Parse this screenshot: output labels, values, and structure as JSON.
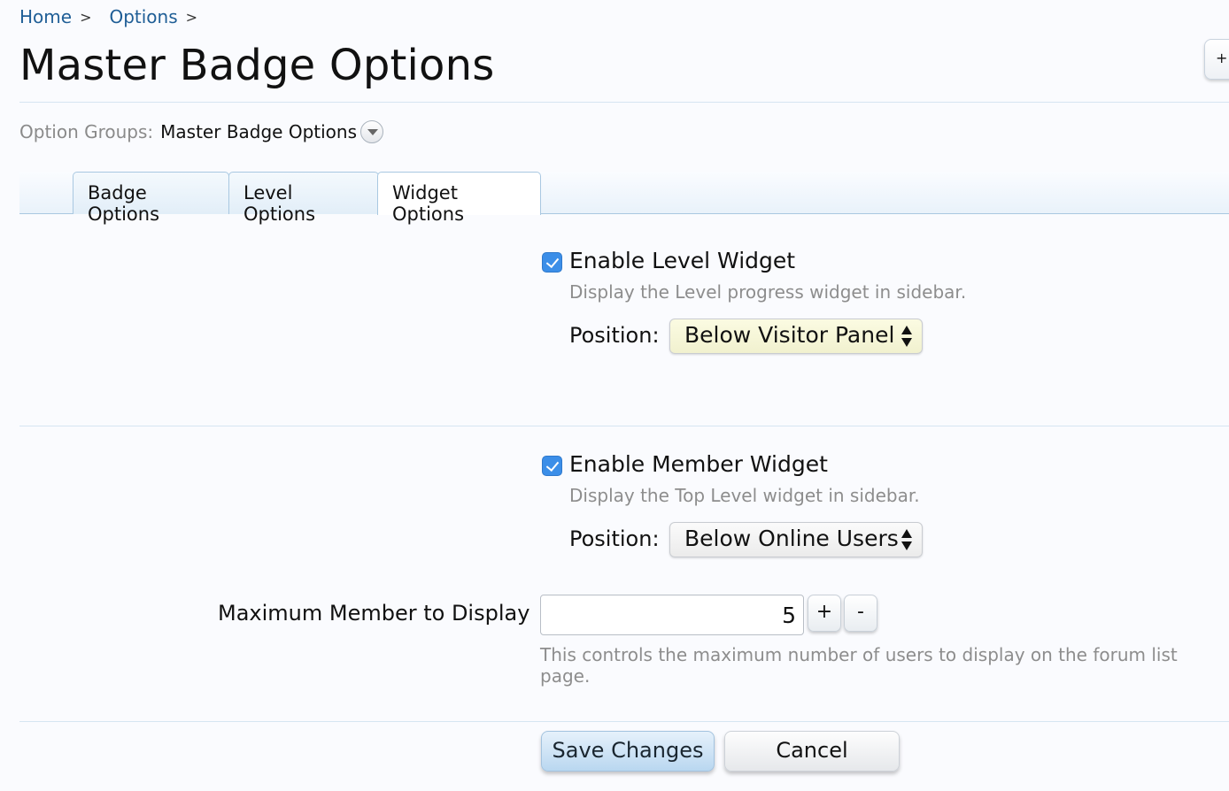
{
  "breadcrumb": {
    "home": "Home",
    "options": "Options",
    "separator": ">"
  },
  "page_title": "Master Badge Options",
  "corner_button_label": "+",
  "option_groups": {
    "label": "Option Groups:",
    "value": "Master Badge Options"
  },
  "tabs": [
    {
      "label": "Badge Options",
      "active": false
    },
    {
      "label": "Level Options",
      "active": false
    },
    {
      "label": "Widget Options",
      "active": true
    }
  ],
  "level_widget": {
    "label": "Enable Level Widget",
    "checked": true,
    "hint": "Display the Level progress widget in sidebar.",
    "position_label": "Position:",
    "position_value": "Below Visitor Panel"
  },
  "member_widget": {
    "label": "Enable Member Widget",
    "checked": true,
    "hint": "Display the Top Level widget in sidebar.",
    "position_label": "Position:",
    "position_value": "Below Online Users"
  },
  "max_members": {
    "label": "Maximum Member to Display",
    "value": "5",
    "increment_label": "+",
    "decrement_label": "-",
    "hint": "This controls the maximum number of users to display on the forum list page."
  },
  "actions": {
    "save_label": "Save Changes",
    "cancel_label": "Cancel"
  },
  "colors": {
    "link": "#1f5e96",
    "checkbox": "#3b8ee8",
    "hint_text": "#8d8d8d",
    "divider": "#d6e5f2"
  },
  "icons": {
    "option_groups_toggle": "chevron-down-icon",
    "select_arrows": "up-down-arrows-icon",
    "checkbox": "checkmark-icon"
  }
}
